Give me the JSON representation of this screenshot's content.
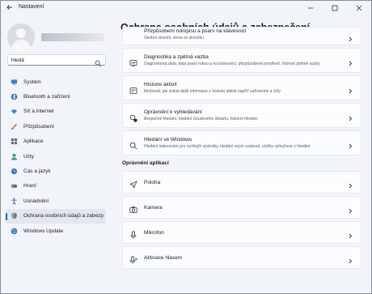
{
  "window": {
    "title": "Nastavení",
    "controls": [
      "minimize-icon",
      "maximize-icon",
      "close-icon"
    ]
  },
  "sidebar": {
    "search": {
      "value": "hledá",
      "placeholder": ""
    },
    "items": [
      {
        "label": "Systém",
        "icon": "monitor-icon",
        "color": "#3a7bd5"
      },
      {
        "label": "Bluetooth a zařízení",
        "icon": "bluetooth-icon",
        "color": "#2f6fd0"
      },
      {
        "label": "Síť a internet",
        "icon": "wifi-icon",
        "color": "#3a7bd5"
      },
      {
        "label": "Přizpůsobení",
        "icon": "brush-icon",
        "color": "#d9822b"
      },
      {
        "label": "Aplikace",
        "icon": "apps-icon",
        "color": "#5a6b82"
      },
      {
        "label": "Účty",
        "icon": "person-icon",
        "color": "#2ea36b"
      },
      {
        "label": "Čas a jazyk",
        "icon": "globe-clock-icon",
        "color": "#2f6fd0"
      },
      {
        "label": "Hraní",
        "icon": "gamepad-icon",
        "color": "#6b6b6b"
      },
      {
        "label": "Usnadnění",
        "icon": "accessibility-icon",
        "color": "#2f6fd0"
      },
      {
        "label": "Ochrana osobních údajů a zabezp",
        "icon": "shield-icon",
        "color": "#6b7380",
        "selected": true
      },
      {
        "label": "Windows Update",
        "icon": "update-icon",
        "color": "#2f6fd0"
      }
    ]
  },
  "main": {
    "title": "Ochrana osobních údajů a zabezpečení",
    "cards": [
      {
        "title": "Přizpůsobení rukopisu a psaní na klávesnici",
        "subtitle": "Osobní slovník, slova ve slovníku",
        "icon": "pen-icon",
        "cut": true
      },
      {
        "title": "Diagnostika a zpětná vazba",
        "subtitle": "Diagnostická data, data psaní rukou a na klávesnici, přizpůsobené prostředí, četnost zpětné vazby",
        "icon": "diagnostics-icon"
      },
      {
        "title": "Historie aktivit",
        "subtitle": "Možnosti, jak získat další informace z historie aktivit napříč zařízeními a účty",
        "icon": "history-icon"
      },
      {
        "title": "Oprávnění k vyhledávání",
        "subtitle": "Bezpečné hledání, hledání cloudového obsahu, historie hledání",
        "icon": "search-shield-icon"
      },
      {
        "title": "Hledání ve Windows",
        "subtitle": "Hledání indexování pro rychlejší výsledky, hledání mých souborů, složky vyloučené z hledání",
        "icon": "search-icon"
      }
    ],
    "section_title": "Oprávnění aplikací",
    "app_permissions": [
      {
        "title": "Poloha",
        "icon": "location-icon"
      },
      {
        "title": "Kamera",
        "icon": "camera-icon"
      },
      {
        "title": "Mikrofon",
        "icon": "microphone-icon"
      },
      {
        "title": "Aktivace hlasem",
        "icon": "voice-activation-icon"
      }
    ]
  }
}
